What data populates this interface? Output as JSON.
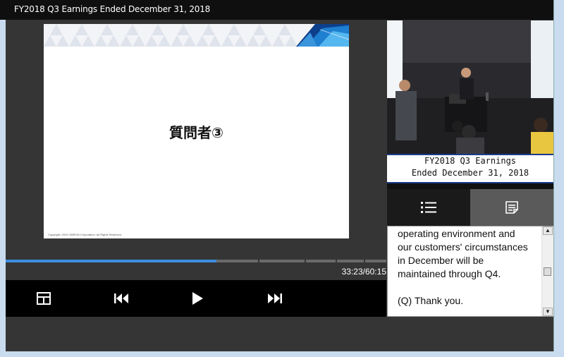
{
  "window": {
    "title": "FY2018 Q3 Earnings Ended December 31, 2018"
  },
  "slide": {
    "title": "質問者③",
    "copyright": "Copyright: 2019 OMRON Corporation. All Rights Reserved."
  },
  "video": {
    "caption_line1": "FY2018 Q3 Earnings",
    "caption_line2": "Ended December 31, 2018"
  },
  "tabs": [
    {
      "icon": "list-icon",
      "active": false
    },
    {
      "icon": "notes-icon",
      "active": true
    }
  ],
  "transcript": {
    "paragraph1": "operating environment and our customers' circumstances in December will be maintained through Q4.",
    "paragraph2": "(Q) Thank you."
  },
  "player": {
    "time": "33:23/60:15",
    "progress": 0.554,
    "accent_color": "#3b8ee0",
    "controls": [
      "layout-icon",
      "previous-icon",
      "play-icon",
      "next-icon"
    ]
  }
}
